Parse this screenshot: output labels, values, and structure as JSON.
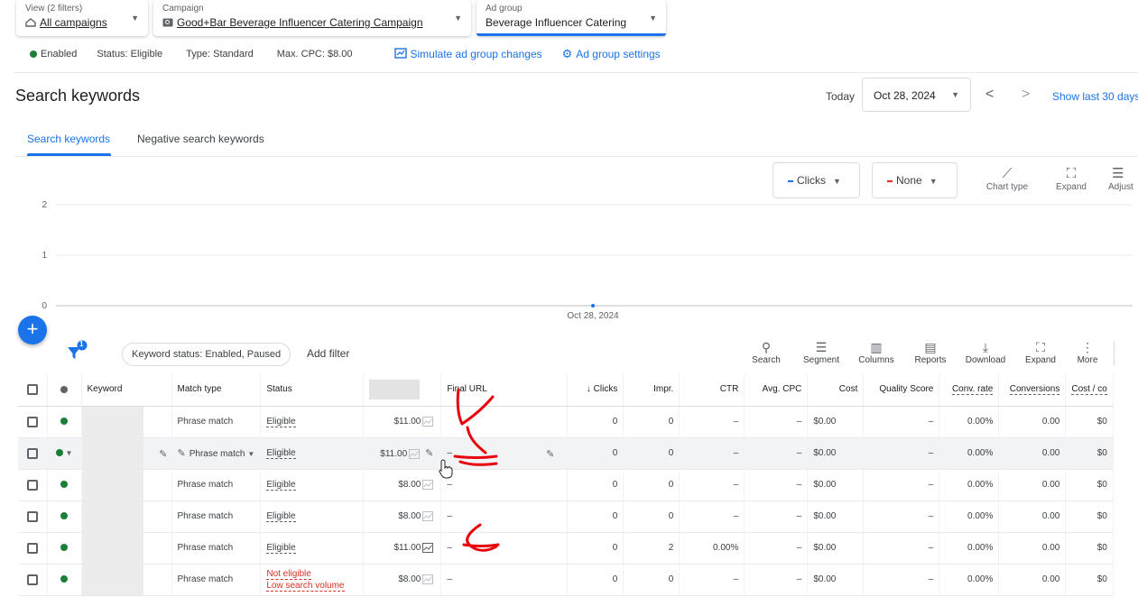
{
  "selectors": {
    "view": {
      "label": "View (2 filters)",
      "value": "All campaigns"
    },
    "campaign": {
      "label": "Campaign",
      "value": "Good+Bar Beverage Influencer Catering Campaign"
    },
    "ad_group": {
      "label": "Ad group",
      "value": "Beverage Influencer Catering"
    }
  },
  "status_row": {
    "enabled": "Enabled",
    "status": "Status: Eligible",
    "type": "Type: Standard",
    "max_cpc": "Max. CPC: $8.00",
    "simulate": "Simulate ad group changes",
    "settings": "Ad group settings"
  },
  "header": {
    "title": "Search keywords",
    "today": "Today",
    "date": "Oct 28, 2024",
    "show_last": "Show last 30 days"
  },
  "tabs": [
    "Search keywords",
    "Negative search keywords"
  ],
  "chart_controls": {
    "metric1": "Clicks",
    "metric2": "None",
    "chart_type": "Chart type",
    "expand": "Expand",
    "adjust": "Adjust"
  },
  "colors": {
    "accent": "#1a73e8",
    "metric1": "#1a73e8",
    "metric2": "#d93025",
    "enabled": "#188038",
    "annotation": "#e8000b"
  },
  "chart_data": {
    "type": "line",
    "x": [
      "Oct 28, 2024"
    ],
    "series": [
      {
        "values": [
          0
        ]
      }
    ],
    "yticks": [
      0,
      1,
      2
    ],
    "ylim": [
      0,
      2
    ],
    "grid": true
  },
  "filterbar": {
    "filter_count": "1",
    "chip": "Keyword status: Enabled, Paused",
    "add_filter": "Add filter",
    "tools": [
      "Search",
      "Segment",
      "Columns",
      "Reports",
      "Download",
      "Expand",
      "More"
    ]
  },
  "table": {
    "columns": {
      "keyword": "Keyword",
      "match_type": "Match type",
      "status": "Status",
      "final_url": "Final URL",
      "clicks": "Clicks",
      "impr": "Impr.",
      "ctr": "CTR",
      "avg_cpc": "Avg. CPC",
      "cost": "Cost",
      "quality": "Quality Score",
      "conv_rate": "Conv. rate",
      "conversions": "Conversions",
      "cost_conv": "Cost / co"
    },
    "rows": [
      {
        "match": "Phrase match",
        "status": "Eligible",
        "status2": "",
        "bid": "$11.00",
        "url": "",
        "clicks": "0",
        "impr": "0",
        "ctr": "–",
        "cpc": "–",
        "cost": "$0.00",
        "qs": "–",
        "conv_rate": "0.00%",
        "conv": "0.00",
        "cost_conv": "$0"
      },
      {
        "match": "Phrase match",
        "status": "Eligible",
        "status2": "",
        "bid": "$11.00",
        "url": "–",
        "clicks": "0",
        "impr": "0",
        "ctr": "–",
        "cpc": "–",
        "cost": "$0.00",
        "qs": "–",
        "conv_rate": "0.00%",
        "conv": "0.00",
        "cost_conv": "$0"
      },
      {
        "match": "Phrase match",
        "status": "Eligible",
        "status2": "",
        "bid": "$8.00",
        "url": "–",
        "clicks": "0",
        "impr": "0",
        "ctr": "–",
        "cpc": "–",
        "cost": "$0.00",
        "qs": "–",
        "conv_rate": "0.00%",
        "conv": "0.00",
        "cost_conv": "$0"
      },
      {
        "match": "Phrase match",
        "status": "Eligible",
        "status2": "",
        "bid": "$8.00",
        "url": "–",
        "clicks": "0",
        "impr": "0",
        "ctr": "–",
        "cpc": "–",
        "cost": "$0.00",
        "qs": "–",
        "conv_rate": "0.00%",
        "conv": "0.00",
        "cost_conv": "$0"
      },
      {
        "match": "Phrase match",
        "status": "Eligible",
        "status2": "",
        "bid": "$11.00",
        "url": "–",
        "clicks": "0",
        "impr": "2",
        "ctr": "0.00%",
        "cpc": "–",
        "cost": "$0.00",
        "qs": "–",
        "conv_rate": "0.00%",
        "conv": "0.00",
        "cost_conv": "$0"
      },
      {
        "match": "Phrase match",
        "status": "Not eligible",
        "status2": "Low search volume",
        "bid": "$8.00",
        "url": "–",
        "clicks": "0",
        "impr": "0",
        "ctr": "–",
        "cpc": "–",
        "cost": "$0.00",
        "qs": "–",
        "conv_rate": "0.00%",
        "conv": "0.00",
        "cost_conv": "$0"
      }
    ]
  }
}
